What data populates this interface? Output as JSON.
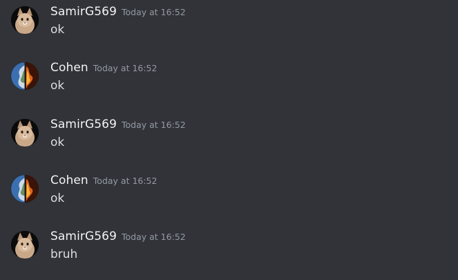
{
  "colors": {
    "background": "#313338",
    "username": "#f2f3f5",
    "timestamp": "#949ba4",
    "message_text": "#dbdee1"
  },
  "messages": [
    {
      "author": "SamirG569",
      "timestamp": "Today at 16:52",
      "content": "ok",
      "avatar_icon": "cat-avatar-icon"
    },
    {
      "author": "Cohen",
      "timestamp": "Today at 16:52",
      "content": "ok",
      "avatar_icon": "earth-fire-avatar-icon"
    },
    {
      "author": "SamirG569",
      "timestamp": "Today at 16:52",
      "content": "ok",
      "avatar_icon": "cat-avatar-icon"
    },
    {
      "author": "Cohen",
      "timestamp": "Today at 16:52",
      "content": "ok",
      "avatar_icon": "earth-fire-avatar-icon"
    },
    {
      "author": "SamirG569",
      "timestamp": "Today at 16:52",
      "content": "bruh",
      "avatar_icon": "cat-avatar-icon"
    }
  ]
}
